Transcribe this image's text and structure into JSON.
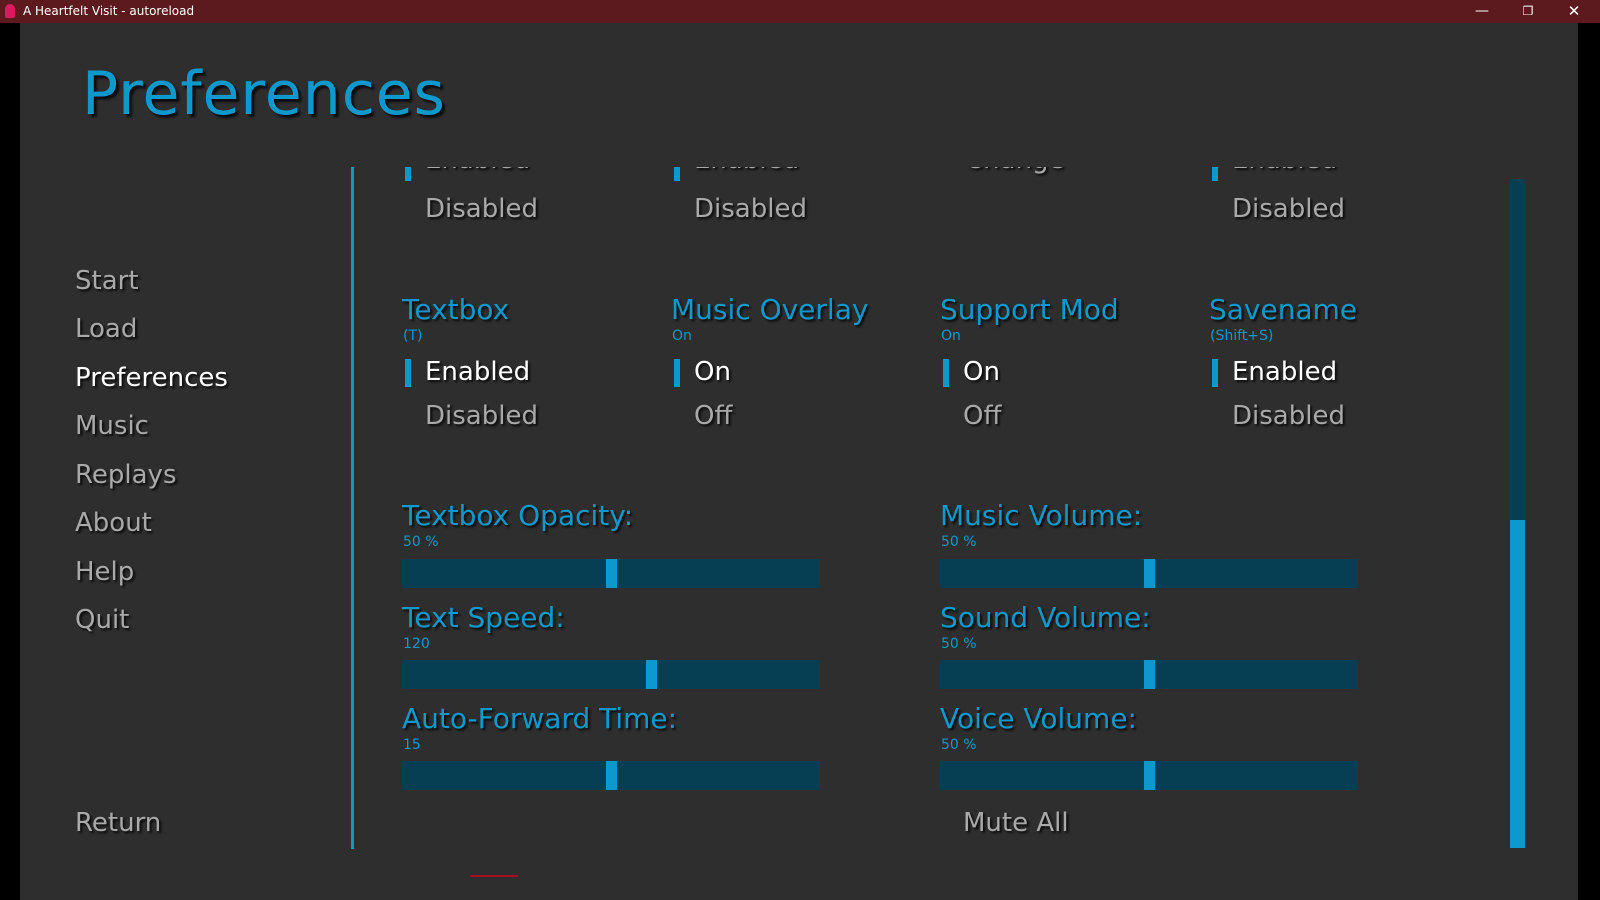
{
  "window": {
    "title": "A Heartfelt Visit - autoreload",
    "minimize": "—",
    "maximize": "❐",
    "close": "✕"
  },
  "page_title": "Preferences",
  "nav": {
    "items": [
      {
        "label": "Start"
      },
      {
        "label": "Load"
      },
      {
        "label": "Preferences",
        "active": true
      },
      {
        "label": "Music"
      },
      {
        "label": "Replays"
      },
      {
        "label": "About"
      },
      {
        "label": "Help"
      },
      {
        "label": "Quit"
      }
    ],
    "return_label": "Return"
  },
  "scrolled_row": {
    "col1": {
      "cut": "Enabled",
      "option": "Disabled"
    },
    "col2": {
      "cut": "Enabled",
      "option": "Disabled"
    },
    "col3": {
      "cut": "Change"
    },
    "col4": {
      "cut": "Enabled",
      "option": "Disabled"
    }
  },
  "groups": {
    "textbox": {
      "title": "Textbox",
      "sub": "(T)",
      "opt1": "Enabled",
      "opt2": "Disabled"
    },
    "music_overlay": {
      "title": "Music Overlay",
      "sub": "On",
      "opt1": "On",
      "opt2": "Off"
    },
    "support_mod": {
      "title": "Support Mod",
      "sub": "On",
      "opt1": "On",
      "opt2": "Off"
    },
    "savename": {
      "title": "Savename",
      "sub": "(Shift+S)",
      "opt1": "Enabled",
      "opt2": "Disabled"
    }
  },
  "sliders": {
    "textbox_opacity": {
      "label": "Textbox Opacity:",
      "value_text": "50 %",
      "level": 0.5
    },
    "text_speed": {
      "label": "Text Speed:",
      "value_text": "120",
      "level": 0.6
    },
    "auto_forward": {
      "label": "Auto-Forward Time:",
      "value_text": "15",
      "level": 0.5
    },
    "music_volume": {
      "label": "Music Volume:",
      "value_text": "50 %",
      "level": 0.5
    },
    "sound_volume": {
      "label": "Sound Volume:",
      "value_text": "50 %",
      "level": 0.5
    },
    "voice_volume": {
      "label": "Voice Volume:",
      "value_text": "50 %",
      "level": 0.5
    }
  },
  "mute_all": "Mute All",
  "scrollbar": {
    "thumb_start": 0.51,
    "thumb_end": 1.0
  },
  "colors": {
    "accent": "#0e99cc",
    "track": "#063f53",
    "background": "#2e2e2e",
    "inactive_text": "#a9a9a9",
    "titlebar": "#5c1a1e"
  }
}
